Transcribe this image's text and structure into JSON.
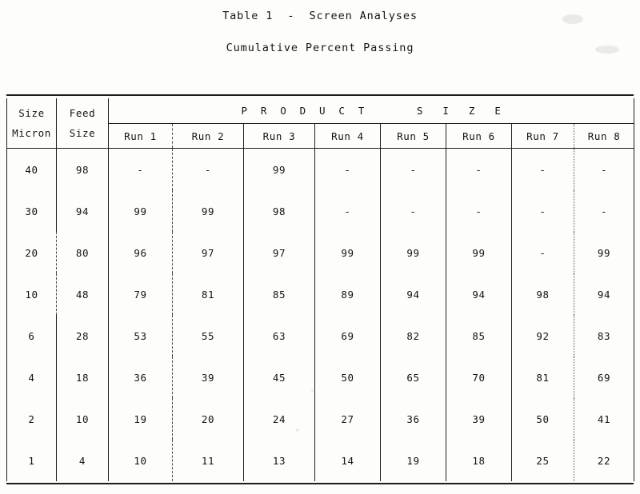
{
  "document": {
    "title_main": "Table 1  -  Screen Analyses",
    "title_sub": "Cumulative Percent Passing"
  },
  "table": {
    "spanning_header": "P  R  O  D  U  C  T        S   I   Z   E",
    "size_header_line1": "Size",
    "size_header_line2": "Micron",
    "feed_header_line1": "Feed",
    "feed_header_line2": "Size",
    "run_headers": [
      "Run 1",
      "Run 2",
      "Run 3",
      "Run 4",
      "Run 5",
      "Run 6",
      "Run 7",
      "Run 8"
    ],
    "null_marker": "-",
    "rows": [
      {
        "size_micron": "40",
        "feed_size": "98",
        "runs": [
          "-",
          "-",
          "99",
          "-",
          "-",
          "-",
          "-",
          "-"
        ]
      },
      {
        "size_micron": "30",
        "feed_size": "94",
        "runs": [
          "99",
          "99",
          "98",
          "-",
          "-",
          "-",
          "-",
          "-"
        ]
      },
      {
        "size_micron": "20",
        "feed_size": "80",
        "runs": [
          "96",
          "97",
          "97",
          "99",
          "99",
          "99",
          "-",
          "99"
        ]
      },
      {
        "size_micron": "10",
        "feed_size": "48",
        "runs": [
          "79",
          "81",
          "85",
          "89",
          "94",
          "94",
          "98",
          "94"
        ]
      },
      {
        "size_micron": "6",
        "feed_size": "28",
        "runs": [
          "53",
          "55",
          "63",
          "69",
          "82",
          "85",
          "92",
          "83"
        ]
      },
      {
        "size_micron": "4",
        "feed_size": "18",
        "runs": [
          "36",
          "39",
          "45",
          "50",
          "65",
          "70",
          "81",
          "69"
        ]
      },
      {
        "size_micron": "2",
        "feed_size": "10",
        "runs": [
          "19",
          "20",
          "24",
          "27",
          "36",
          "39",
          "50",
          "41"
        ]
      },
      {
        "size_micron": "1",
        "feed_size": "4",
        "runs": [
          "10",
          "11",
          "13",
          "14",
          "19",
          "18",
          "25",
          "22"
        ]
      }
    ]
  },
  "chart_data": {
    "type": "table",
    "title": "Table 1 - Screen Analyses",
    "subtitle": "Cumulative Percent Passing",
    "xlabel": "Product Size (Run)",
    "ylabel": "Cumulative Percent Passing",
    "index_name": "Size Micron",
    "columns": [
      "Size Micron",
      "Feed Size",
      "Run 1",
      "Run 2",
      "Run 3",
      "Run 4",
      "Run 5",
      "Run 6",
      "Run 7",
      "Run 8"
    ],
    "index": [
      40,
      30,
      20,
      10,
      6,
      4,
      2,
      1
    ],
    "series": [
      {
        "name": "Feed Size",
        "values": [
          98,
          94,
          80,
          48,
          28,
          18,
          10,
          4
        ]
      },
      {
        "name": "Run 1",
        "values": [
          null,
          99,
          96,
          79,
          53,
          36,
          19,
          10
        ]
      },
      {
        "name": "Run 2",
        "values": [
          null,
          99,
          97,
          81,
          55,
          39,
          20,
          11
        ]
      },
      {
        "name": "Run 3",
        "values": [
          99,
          98,
          97,
          85,
          63,
          45,
          24,
          13
        ]
      },
      {
        "name": "Run 4",
        "values": [
          null,
          null,
          99,
          89,
          69,
          50,
          27,
          14
        ]
      },
      {
        "name": "Run 5",
        "values": [
          null,
          null,
          99,
          94,
          82,
          65,
          36,
          19
        ]
      },
      {
        "name": "Run 6",
        "values": [
          null,
          null,
          99,
          94,
          85,
          70,
          39,
          18
        ]
      },
      {
        "name": "Run 7",
        "values": [
          null,
          null,
          null,
          98,
          92,
          81,
          50,
          25
        ]
      },
      {
        "name": "Run 8",
        "values": [
          null,
          null,
          99,
          94,
          83,
          69,
          41,
          22
        ]
      }
    ],
    "rows": [
      [
        40,
        98,
        null,
        null,
        99,
        null,
        null,
        null,
        null,
        null
      ],
      [
        30,
        94,
        99,
        99,
        98,
        null,
        null,
        null,
        null,
        null
      ],
      [
        20,
        80,
        96,
        97,
        97,
        99,
        99,
        99,
        null,
        99
      ],
      [
        10,
        48,
        79,
        81,
        85,
        89,
        94,
        94,
        98,
        94
      ],
      [
        6,
        28,
        53,
        55,
        63,
        69,
        82,
        85,
        92,
        83
      ],
      [
        4,
        18,
        36,
        39,
        45,
        50,
        65,
        70,
        81,
        69
      ],
      [
        2,
        10,
        19,
        20,
        24,
        27,
        36,
        39,
        50,
        41
      ],
      [
        1,
        4,
        10,
        11,
        13,
        14,
        19,
        18,
        25,
        22
      ]
    ],
    "null_marker": "-",
    "units": "percent",
    "grid": true,
    "legend": "none"
  }
}
